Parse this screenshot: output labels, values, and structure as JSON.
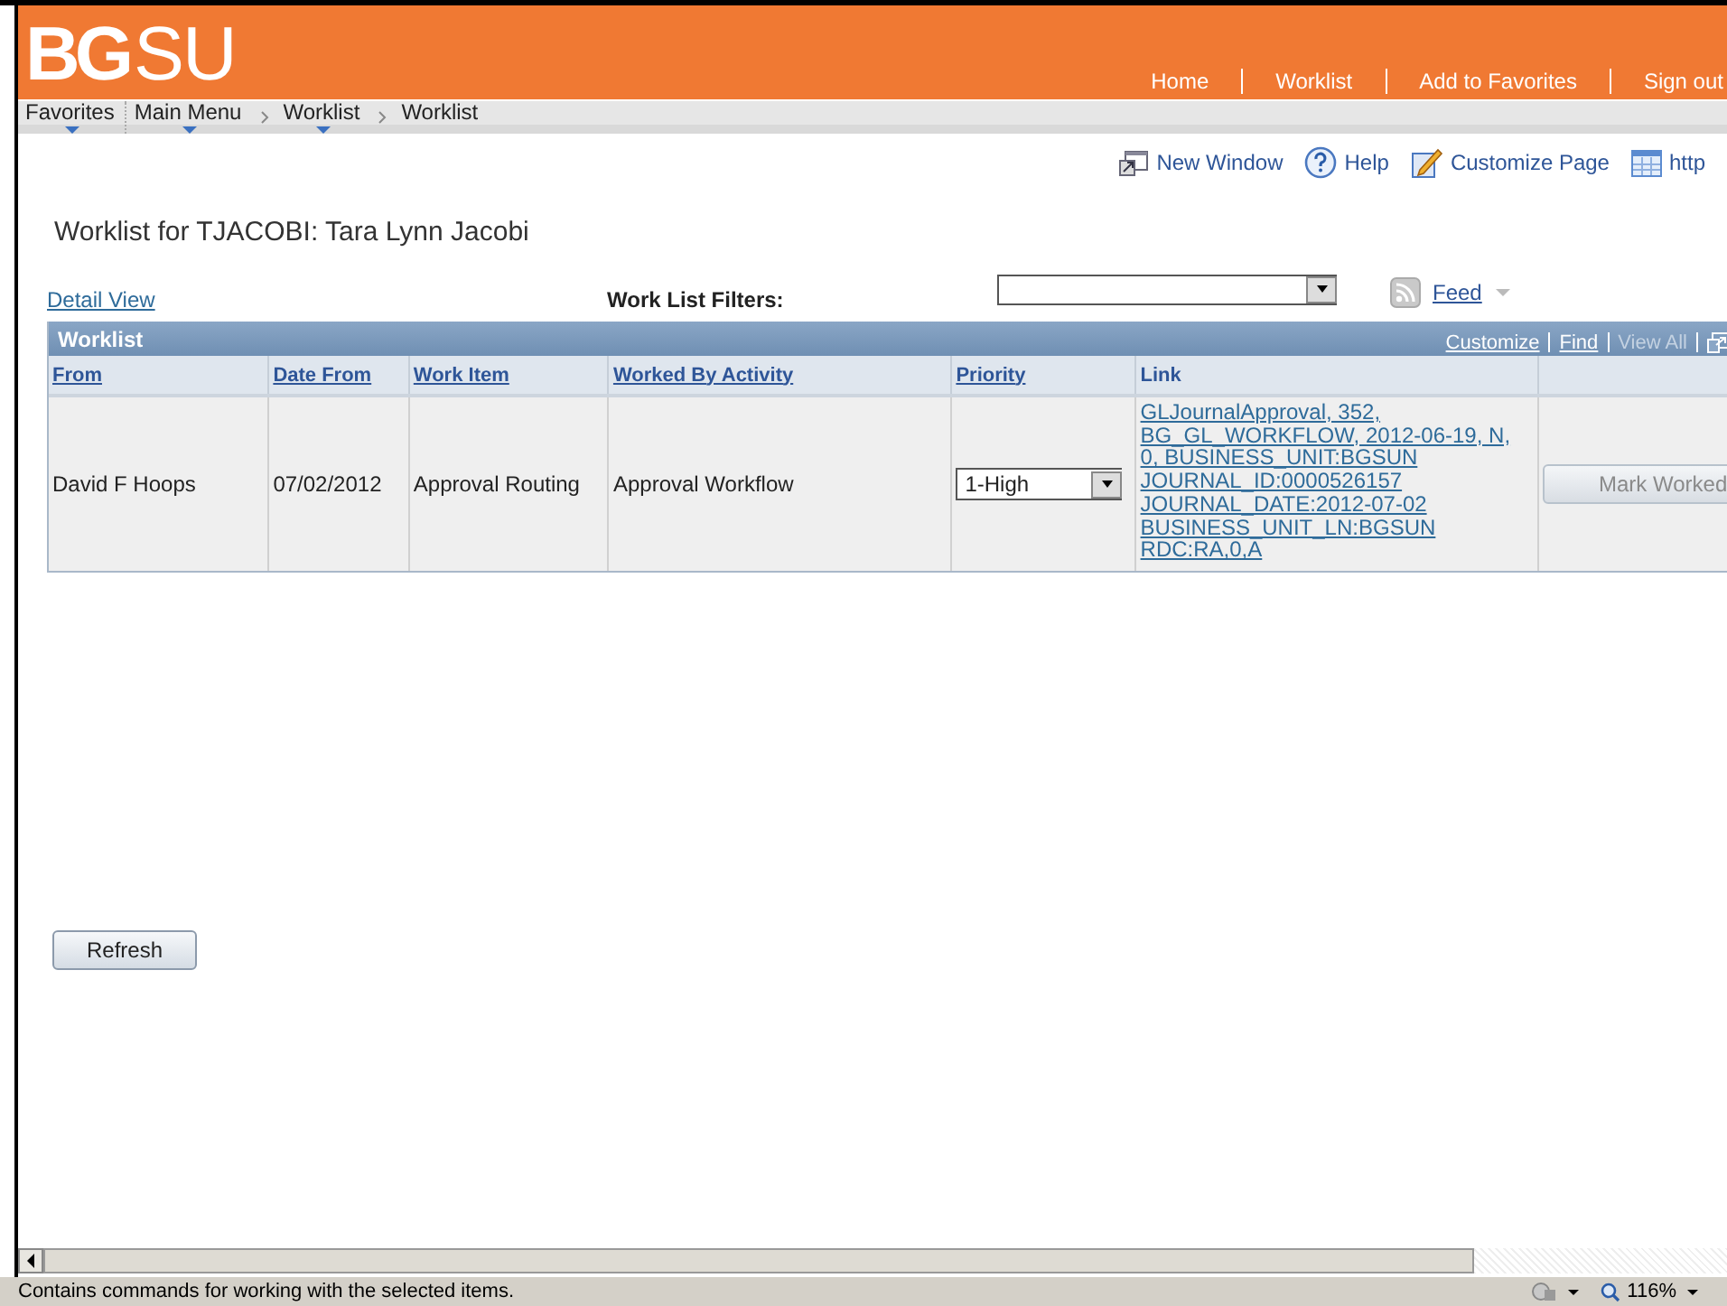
{
  "header": {
    "logo_bold": "BG",
    "logo_light": "SU",
    "links": [
      "Home",
      "Worklist",
      "Add to Favorites",
      "Sign out"
    ]
  },
  "breadcrumb": [
    {
      "label": "Favorites",
      "menu": true
    },
    {
      "label": "Main Menu",
      "menu": true
    },
    {
      "label": "Worklist",
      "menu": true
    },
    {
      "label": "Worklist",
      "menu": false
    }
  ],
  "toolbar": [
    {
      "kind": "window",
      "label": "New Window"
    },
    {
      "kind": "help",
      "label": "Help"
    },
    {
      "kind": "customize",
      "label": "Customize Page"
    },
    {
      "kind": "table",
      "label": "http"
    }
  ],
  "page_title": "Worklist for TJACOBI: Tara Lynn Jacobi",
  "detail_view": "Detail View",
  "filters": {
    "label": "Work List Filters:"
  },
  "feed": "Feed",
  "grid": {
    "title": "Worklist",
    "actions": [
      {
        "label": "Customize",
        "disabled": false
      },
      {
        "label": "Find",
        "disabled": false
      },
      {
        "label": "View All",
        "disabled": true
      }
    ],
    "columns": [
      {
        "label": "From",
        "sortable": true
      },
      {
        "label": "Date From",
        "sortable": true
      },
      {
        "label": "Work Item",
        "sortable": true
      },
      {
        "label": "Worked By Activity",
        "sortable": true
      },
      {
        "label": "Priority",
        "sortable": true
      },
      {
        "label": "Link",
        "sortable": false
      }
    ],
    "rows": [
      {
        "from": "David F Hoops",
        "date_from": "07/02/2012",
        "work_item": "Approval Routing",
        "activity": "Approval Workflow",
        "priority": "1-High",
        "link": [
          "GLJournalApproval, 352,",
          "BG_GL_WORKFLOW, 2012-06-19, N,",
          "0, BUSINESS_UNIT:BGSUN",
          "JOURNAL_ID:0000526157",
          "JOURNAL_DATE:2012-07-02",
          "BUSINESS_UNIT_LN:BGSUN",
          "RDC:RA,0,A"
        ],
        "button": {
          "label": "Mark Worked",
          "disabled": true
        }
      }
    ]
  },
  "refresh": "Refresh",
  "status_bar": {
    "text": "Contains commands for working with the selected items.",
    "zoom": "116%"
  }
}
